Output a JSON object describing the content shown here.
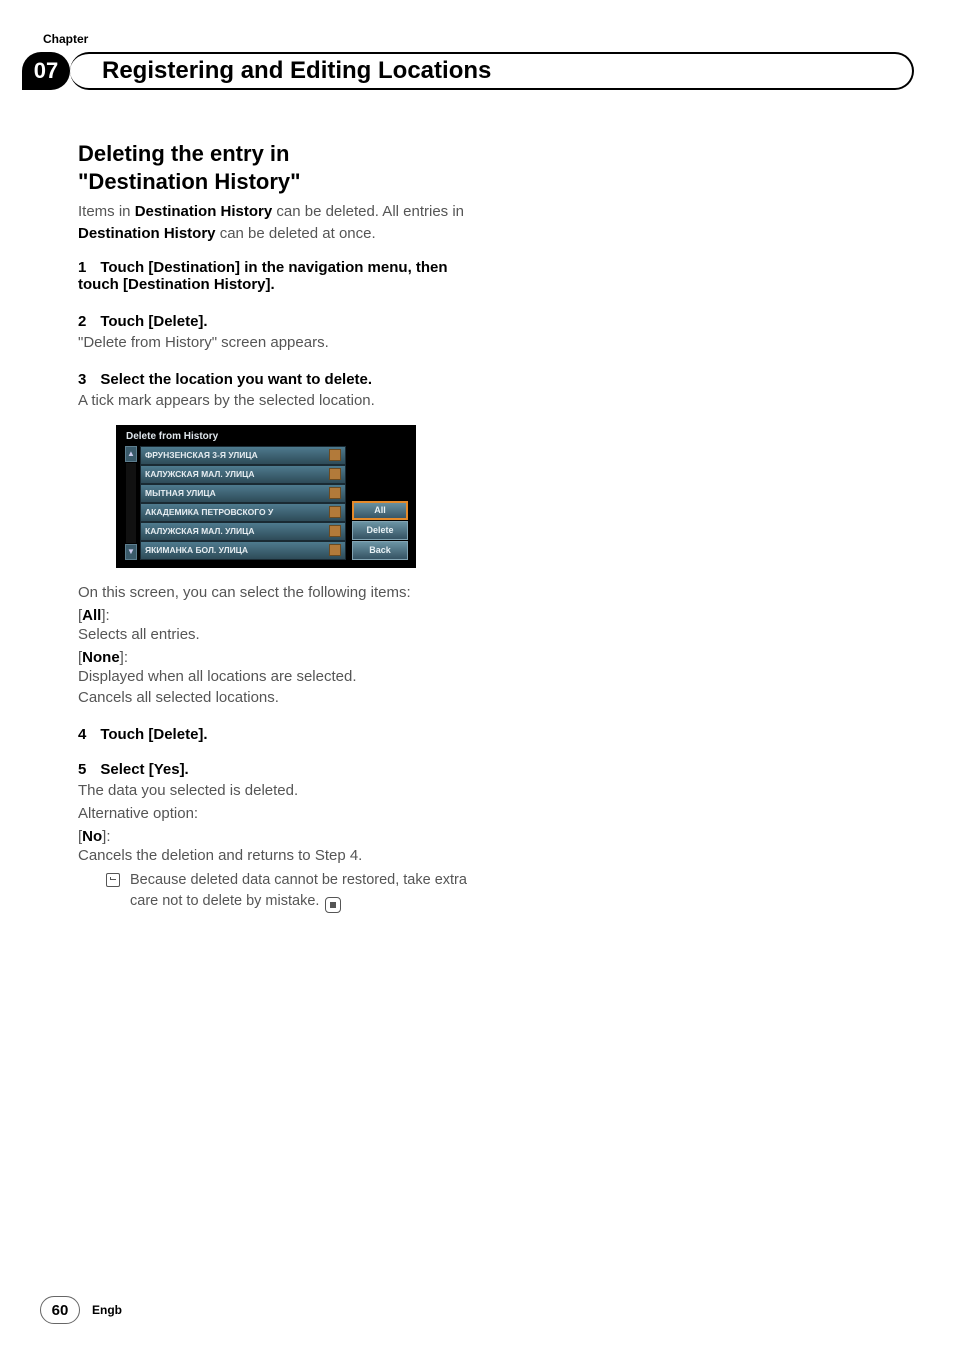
{
  "chapter": {
    "label": "Chapter",
    "number": "07"
  },
  "header": {
    "title": "Registering and Editing Locations"
  },
  "section": {
    "heading_line1": "Deleting the entry in",
    "heading_line2": "\"Destination History\"",
    "intro_pre": "Items in ",
    "intro_bold1": "Destination History",
    "intro_mid": " can be deleted. All entries in ",
    "intro_bold2": "Destination History",
    "intro_post": " can be deleted at once."
  },
  "steps": {
    "s1_num": "1",
    "s1_text": "Touch [Destination] in the navigation menu, then touch [Destination History].",
    "s2_num": "2",
    "s2_text": "Touch [Delete].",
    "s2_follow": "\"Delete from History\" screen appears.",
    "s3_num": "3",
    "s3_text": "Select the location you want to delete.",
    "s3_follow": "A tick mark appears by the selected location.",
    "s4_num": "4",
    "s4_text": "Touch [Delete].",
    "s5_num": "5",
    "s5_text": "Select [Yes].",
    "s5_follow": "The data you selected is deleted.",
    "s5_alt": "Alternative option:"
  },
  "screenshot": {
    "title": "Delete from History",
    "items": [
      "ФРУНЗЕНСКАЯ 3-Я УЛИЦА",
      "КАЛУЖСКАЯ МАЛ. УЛИЦА",
      "МЫТНАЯ УЛИЦА",
      "АКАДЕМИКА ПЕТРОВСКОГО У",
      "КАЛУЖСКАЯ МАЛ. УЛИЦА",
      "ЯКИМАНКА БОЛ. УЛИЦА"
    ],
    "btn_all": "All",
    "btn_delete": "Delete",
    "btn_back": "Back"
  },
  "post_screenshot": {
    "lead": "On this screen, you can select the following items:",
    "all_label": "All",
    "all_desc": "Selects all entries.",
    "none_label": "None",
    "none_desc1": "Displayed when all locations are selected.",
    "none_desc2": "Cancels all selected locations.",
    "no_label": "No",
    "no_desc": "Cancels the deletion and returns to Step 4.",
    "note": "Because deleted data cannot be restored, take extra care not to delete by mistake."
  },
  "footer": {
    "page": "60",
    "lang": "Engb"
  }
}
